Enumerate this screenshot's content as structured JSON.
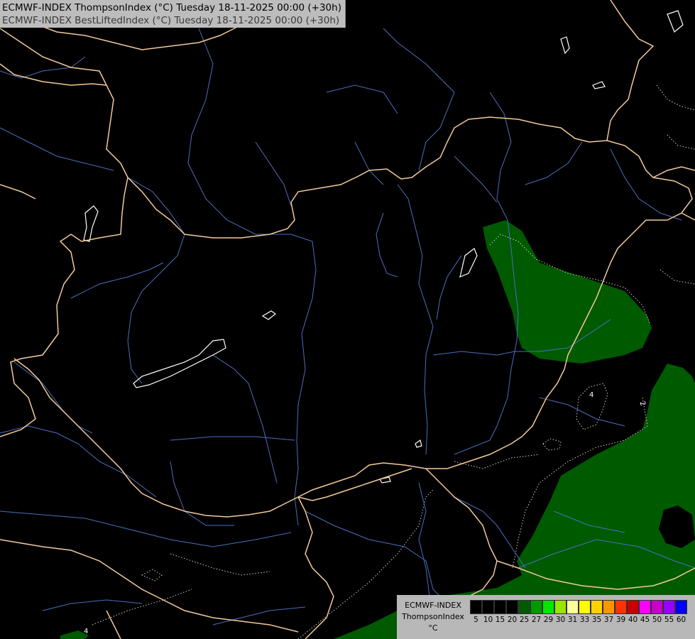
{
  "header": {
    "title_line1": "ECMWF-INDEX ThompsonIndex (°C) Tuesday 18-11-2025 00:00 (+30h)",
    "title_line2": "ECMWF-INDEX BestLiftedIndex (°C) Tuesday 18-11-2025 00:00 (+30h)"
  },
  "map": {
    "background_color": "#000000",
    "border_color": "#f2c99a",
    "river_color": "#4a6fbd",
    "lake_outline_color": "#ffffff",
    "fill_color": "#005a00",
    "contour_labels": [
      "4",
      "4",
      "2"
    ]
  },
  "legend": {
    "model": "ECMWF-INDEX",
    "parameter": "ThompsonIndex",
    "unit": "°C",
    "ticks": [
      "5",
      "10",
      "15",
      "20",
      "25",
      "27",
      "29",
      "30",
      "31",
      "33",
      "35",
      "37",
      "39",
      "40",
      "45",
      "50",
      "55",
      "60"
    ],
    "colors": [
      "#000000",
      "#000000",
      "#000000",
      "#000000",
      "#005a00",
      "#009a00",
      "#00e600",
      "#9be600",
      "#ffff99",
      "#ffff00",
      "#ffd200",
      "#ff9600",
      "#ff3200",
      "#c80000",
      "#ff00ff",
      "#c800c8",
      "#9600ff",
      "#0000ff"
    ]
  }
}
